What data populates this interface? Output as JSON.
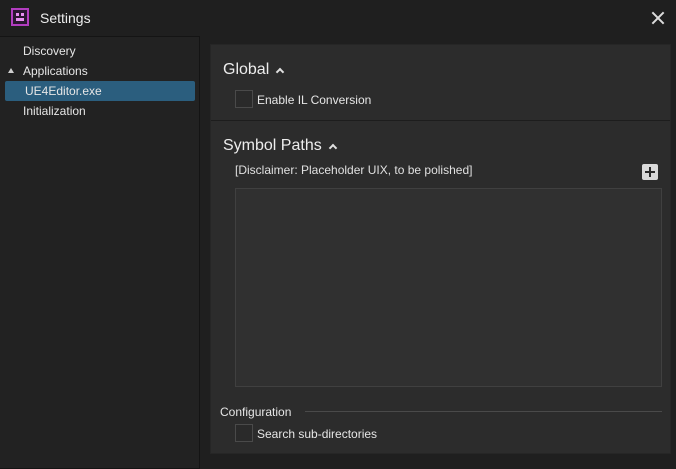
{
  "window": {
    "title": "Settings",
    "app_icon": "app-logo-icon",
    "close_icon": "close-icon"
  },
  "sidebar": {
    "items": [
      {
        "label": "Discovery",
        "level": 0
      },
      {
        "label": "Applications",
        "level": 0,
        "expanded": true
      },
      {
        "label": "UE4Editor.exe",
        "level": 1,
        "selected": true
      },
      {
        "label": "Initialization",
        "level": 0
      }
    ]
  },
  "global": {
    "title": "Global",
    "enable_il_conversion": {
      "label": "Enable IL Conversion",
      "checked": false
    }
  },
  "symbol_paths": {
    "title": "Symbol Paths",
    "disclaimer": "[Disclaimer: Placeholder UIX, to be polished]",
    "add_icon": "plus-icon",
    "paths": []
  },
  "configuration": {
    "title": "Configuration",
    "search_subdirectories": {
      "label": "Search sub-directories",
      "checked": false
    }
  },
  "colors": {
    "background": "#1f1f1f",
    "panel": "#2c2c2c",
    "selection": "#2b5e7e",
    "accent_icon": "#b23dbf"
  }
}
